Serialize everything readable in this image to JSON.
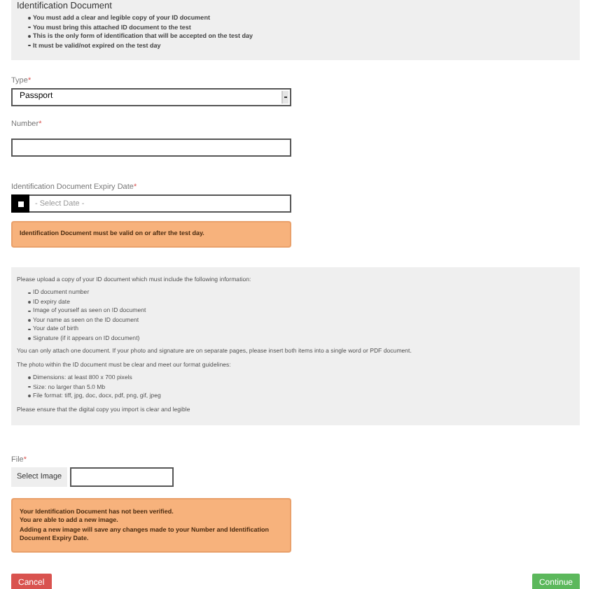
{
  "intro": {
    "title": "Identification Document",
    "bullets": [
      "You must add a clear and legible copy of your ID document",
      "You must bring this attached ID document to the test",
      "This is the only form of identification that will be accepted on the test day",
      "It must be valid/not expired on the test day"
    ]
  },
  "type_field": {
    "label": "Type",
    "required_mark": "*",
    "value": "Passport"
  },
  "number_field": {
    "label": "Number",
    "required_mark": "*"
  },
  "expiry_field": {
    "label": "Identification Document Expiry Date",
    "required_mark": "*",
    "placeholder": "- Select Date -"
  },
  "expiry_warning": [
    "Identification Document must be valid on or after the test day."
  ],
  "info": {
    "intro": "Please upload a copy of your ID document which must include the following information:",
    "items": [
      "ID document number",
      "ID expiry date",
      "Image of yourself as seen on ID document",
      "Your name as seen on the ID document",
      "Your date of birth",
      "Signature (if it appears on ID document)"
    ],
    "attach_note": "You can only attach one document. If your photo and signature are on separate pages, please insert both items into a single word or PDF document.",
    "photo_note": "The photo within the ID document must be clear and meet our format guidelines:",
    "format_items": [
      "Dimensions: at least 800 x 700 pixels",
      "Size: no larger than 5.0 Mb",
      "File format: tiff, jpg, doc, docx, pdf, png, gif, jpeg"
    ],
    "closing": "Please ensure that the digital copy you import is clear and legible"
  },
  "file_field": {
    "label": "File",
    "required_mark": "*",
    "button": "Select Image"
  },
  "file_warning": [
    "Your Identification Document has not been verified.",
    "You are able to add a new image.",
    "Adding a new image will save any changes made to your Number and Identification Document Expiry Date."
  ],
  "buttons": {
    "cancel": "Cancel",
    "continue": "Continue"
  }
}
